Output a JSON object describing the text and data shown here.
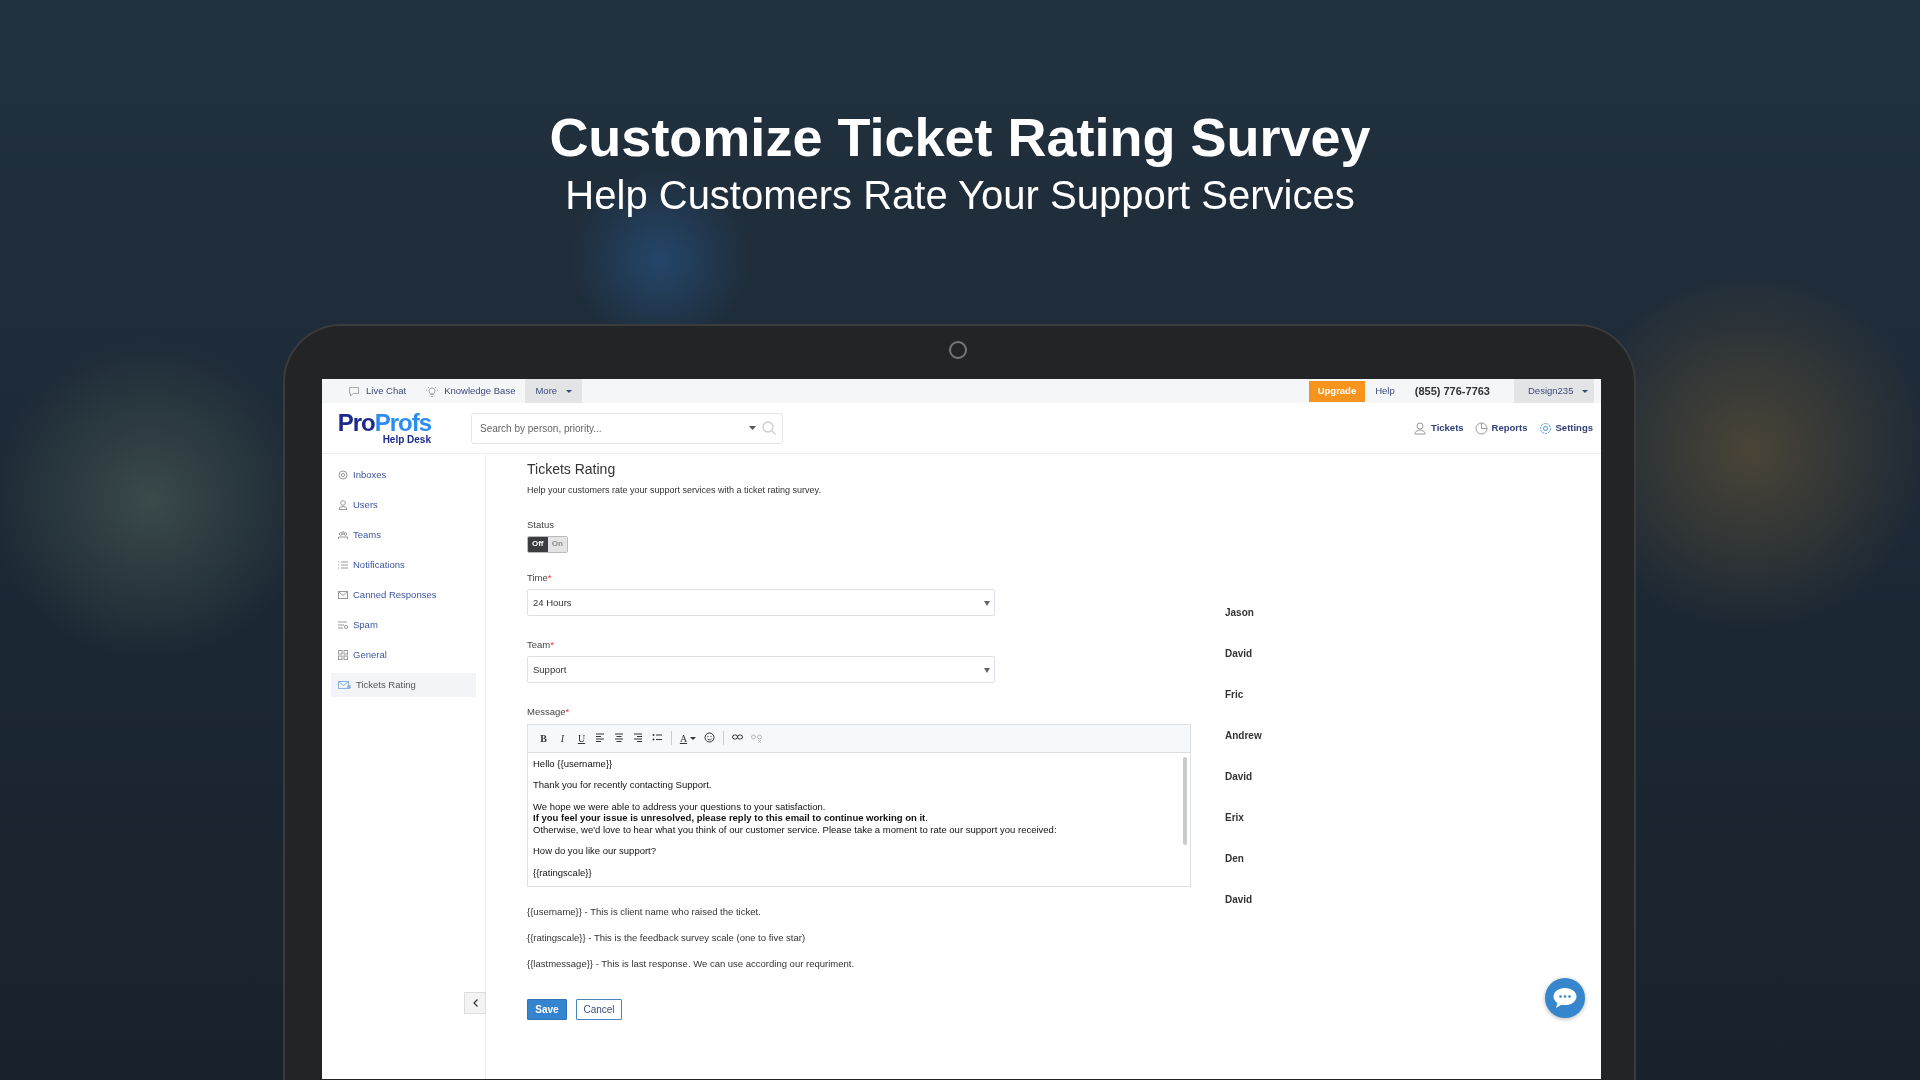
{
  "headline": {
    "title": "Customize Ticket Rating Survey",
    "subtitle": "Help Customers Rate Your Support Services"
  },
  "top_bar": {
    "links": [
      {
        "label": "Live Chat",
        "kind": "chat"
      },
      {
        "label": "Knowledge Base",
        "kind": "bulb"
      },
      {
        "label": "More",
        "kind": "menu"
      }
    ],
    "upgrade": "Upgrade",
    "help": "Help",
    "phone": "(855) 776-7763",
    "user": "Design235"
  },
  "header": {
    "logo": {
      "part_1": "Pro",
      "part_2": "Profs",
      "tagline": "Help Desk"
    },
    "search": {
      "placeholder": "Search by person, priority..."
    },
    "nav": [
      {
        "label": "Tickets"
      },
      {
        "label": "Reports"
      },
      {
        "label": "Settings"
      }
    ]
  },
  "sidebar": {
    "items": [
      {
        "label": "Inboxes",
        "selected": false
      },
      {
        "label": "Users",
        "selected": false
      },
      {
        "label": "Teams",
        "selected": false
      },
      {
        "label": "Notifications",
        "selected": false
      },
      {
        "label": "Canned Responses",
        "selected": false
      },
      {
        "label": "Spam",
        "selected": false
      },
      {
        "label": "General",
        "selected": false
      },
      {
        "label": "Tickets Rating",
        "selected": true
      }
    ]
  },
  "page": {
    "title": "Tickets Rating",
    "description": "Help your customers rate your support services with a ticket rating survey.",
    "status": {
      "label": "Status",
      "options": [
        {
          "label": "Off",
          "selected": true
        },
        {
          "label": "On",
          "selected": false
        }
      ]
    },
    "fields": [
      {
        "label": "Time",
        "required_mark": "*",
        "value": "24 Hours"
      },
      {
        "label": "Team",
        "required_mark": "*",
        "value": "Support"
      }
    ],
    "message": {
      "label": "Message",
      "required_mark": "*",
      "toolbar": [
        {
          "kind": "bold",
          "label": "B"
        },
        {
          "kind": "italic",
          "label": "I"
        },
        {
          "kind": "underline",
          "label": "U"
        },
        {
          "kind": "align-left"
        },
        {
          "kind": "align-center"
        },
        {
          "kind": "align-right"
        },
        {
          "kind": "list"
        },
        {
          "kind": "separator"
        },
        {
          "kind": "font-color",
          "label": "A"
        },
        {
          "kind": "emoji"
        },
        {
          "kind": "separator"
        },
        {
          "kind": "link"
        },
        {
          "kind": "unlink"
        }
      ],
      "paragraphs": [
        [
          "Hello {{username}}"
        ],
        [
          "Thank you for recently contacting Support."
        ],
        [
          "We hope we were able to address your questions to your satisfaction.",
          "**If you feel your issue is unresolved, please reply to this email to continue working on it**.",
          "Otherwise, we'd love to hear what you think of our customer service. Please take a moment to rate our support you received:"
        ],
        [
          "How do you like our support?"
        ],
        [
          "{{ratingscale}}"
        ]
      ]
    },
    "notes": [
      "{{username}} - This is client name who raised the ticket.",
      "{{ratingscale}} - This is the feedback survey scale (one to five star)",
      "{{lastmessage}} - This is last response. We can use according our requriment."
    ],
    "buttons": [
      {
        "label": "Save",
        "kind": "primary"
      },
      {
        "label": "Cancel",
        "kind": "secondary"
      }
    ]
  },
  "names": [
    "Jason",
    "David",
    "Fric",
    "Andrew",
    "David",
    "Erix",
    "Den",
    "David"
  ]
}
